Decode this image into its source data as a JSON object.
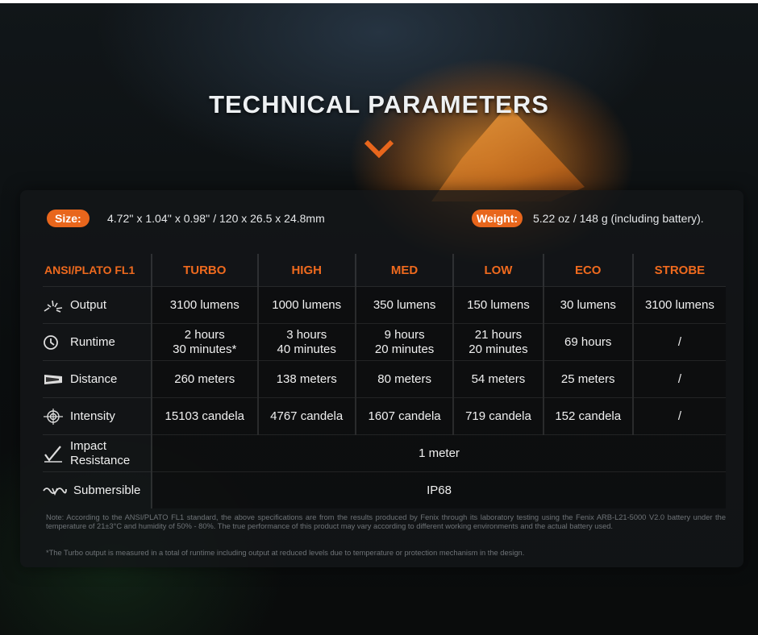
{
  "title": "TECHNICAL PARAMETERS",
  "size": {
    "label": "Size:",
    "value": "4.72'' x 1.04'' x 0.98'' / 120 x 26.5 x 24.8mm"
  },
  "weight": {
    "label": "Weight:",
    "value": "5.22 oz / 148 g (including battery)."
  },
  "table": {
    "standard": "ANSI/PLATO FL1",
    "modes": [
      "TURBO",
      "HIGH",
      "MED",
      "LOW",
      "ECO",
      "STROBE"
    ],
    "output": {
      "label": "Output",
      "icon": "burst-icon",
      "values": [
        "3100 lumens",
        "1000 lumens",
        "350 lumens",
        "150 lumens",
        "30 lumens",
        "3100 lumens"
      ]
    },
    "runtime": {
      "label": "Runtime",
      "icon": "clock-icon",
      "values": [
        [
          "2 hours",
          "30 minutes*"
        ],
        [
          "3 hours",
          "40 minutes"
        ],
        [
          "9 hours",
          "20 minutes"
        ],
        [
          "21 hours",
          "20 minutes"
        ],
        [
          "69 hours",
          ""
        ],
        [
          "/",
          ""
        ]
      ]
    },
    "distance": {
      "label": "Distance",
      "icon": "beam-icon",
      "values": [
        "260 meters",
        "138 meters",
        "80 meters",
        "54 meters",
        "25 meters",
        "/"
      ]
    },
    "intensity": {
      "label": "Intensity",
      "icon": "target-icon",
      "values": [
        "15103 candela",
        "4767 candela",
        "1607 candela",
        "719 candela",
        "152 candela",
        "/"
      ]
    },
    "impact": {
      "label_line1": "Impact",
      "label_line2": "Resistance",
      "icon": "check-impact-icon",
      "value": "1 meter"
    },
    "submersible": {
      "label": "Submersible",
      "icon": "wave-icon",
      "value": "IP68"
    }
  },
  "notes": {
    "note1": "Note: According to the ANSI/PLATO FL1 standard, the above specifications are from the results produced by Fenix through its laboratory testing using the Fenix ARB-L21-5000 V2.0 battery under the temperature of 21±3°C and humidity of 50% - 80%. The true performance of this product may vary according to different working environments and the actual battery used.",
    "note2": "*The Turbo output is measured in a total of runtime including output at reduced levels due to temperature or protection mechanism in the design."
  },
  "colors": {
    "accent": "#e8661c",
    "header_text": "#ef6a1e",
    "text": "#f0f0f0"
  }
}
